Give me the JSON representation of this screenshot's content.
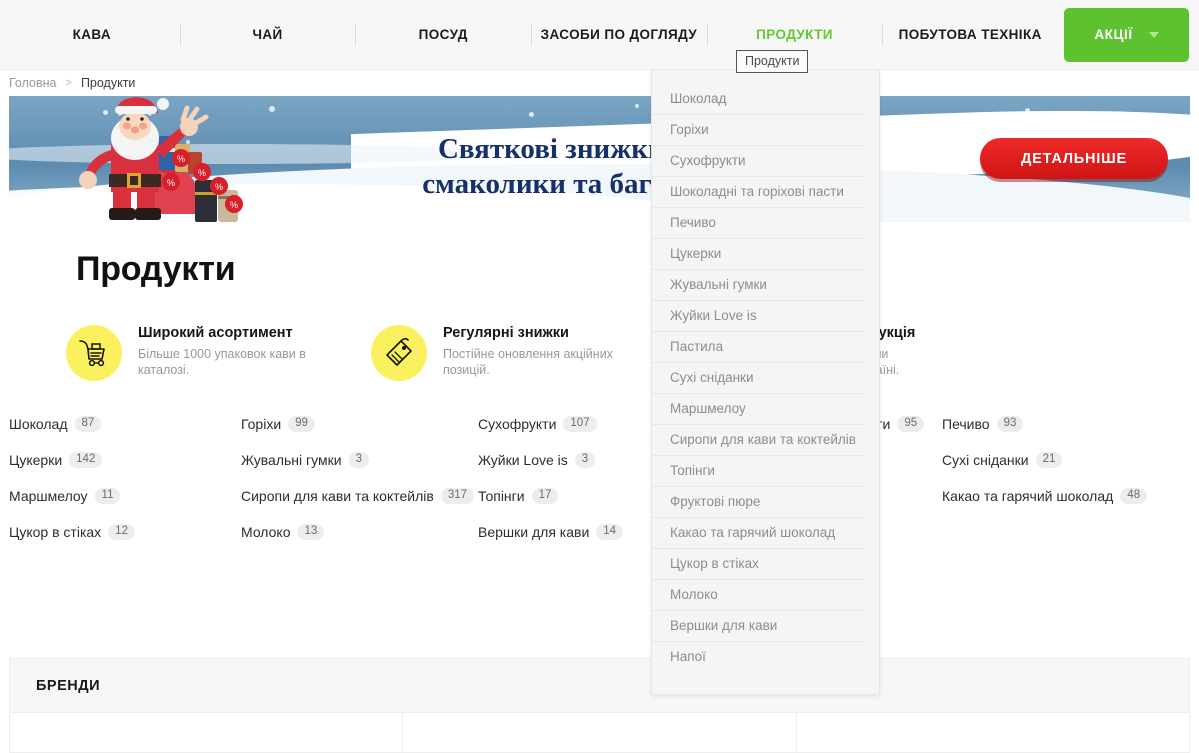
{
  "nav": {
    "items": [
      {
        "label": "КАВА",
        "active": false
      },
      {
        "label": "ЧАЙ",
        "active": false
      },
      {
        "label": "ПОСУД",
        "active": false
      },
      {
        "label": "ЗАСОБИ ПО ДОГЛЯДУ",
        "active": false
      },
      {
        "label": "ПРОДУКТИ",
        "active": true
      },
      {
        "label": "ПОБУТОВА ТЕХНІКА",
        "active": false
      }
    ],
    "promo_button": "АКЦІЇ",
    "active_color": "#64c832",
    "promo_color": "#5cc230"
  },
  "tooltip": {
    "text": "Продукти"
  },
  "dropdown": {
    "items": [
      "Шоколад",
      "Горіхи",
      "Сухофрукти",
      "Шоколадні та горіхові пасти",
      "Печиво",
      "Цукерки",
      "Жувальні гумки",
      "Жуйки Love is",
      "Пастила",
      "Сухі сніданки",
      "Маршмелоу",
      "Сиропи для кави та коктейлів",
      "Топінги",
      "Фруктові пюре",
      "Какао та гарячий шоколад",
      "Цукор в стіках",
      "Молоко",
      "Вершки для кави",
      "Напої"
    ]
  },
  "breadcrumb": {
    "home": "Головна",
    "separator": ">",
    "current": "Продукти"
  },
  "banner": {
    "line1": "Святкові знижки до -40%",
    "line2": "смаколики та багато іншого",
    "button": "ДЕТАЛЬНІШЕ",
    "button_color": "#e02222"
  },
  "page": {
    "title": "Продукти"
  },
  "features": [
    {
      "icon": "shopping-cart-icon",
      "title": "Широкий асортимент",
      "desc": "Більше 1000 упаковок кави в каталозі."
    },
    {
      "icon": "price-tag-icon",
      "title": "Регулярні знижки",
      "desc": "Постійне оновлення акційних позицій."
    },
    {
      "icon": "badge-check-icon",
      "title": "Оригінальна продукція",
      "desc": "Працюємо з офіційними постачальниками в країні."
    }
  ],
  "categories": [
    {
      "label": "Шоколад",
      "count": "87"
    },
    {
      "label": "Горіхи",
      "count": "99"
    },
    {
      "label": "Сухофрукти",
      "count": "107"
    },
    {
      "label": "Шоколадні та горіхові пасти",
      "count": "95"
    },
    {
      "label": "Печиво",
      "count": "93"
    },
    {
      "label": "Цукерки",
      "count": "142"
    },
    {
      "label": "Жувальні гумки",
      "count": "3"
    },
    {
      "label": "Жуйки Love is",
      "count": "3"
    },
    {
      "label": "Пастила",
      "count": ""
    },
    {
      "label": "Сухі сніданки",
      "count": "21"
    },
    {
      "label": "Маршмелоу",
      "count": "11"
    },
    {
      "label": "Сиропи для кави та коктейлів",
      "count": "317"
    },
    {
      "label": "Топінги",
      "count": "17"
    },
    {
      "label": "Фруктові пюре",
      "count": ""
    },
    {
      "label": "Какао та гарячий шоколад",
      "count": "48"
    },
    {
      "label": "Цукор в стіках",
      "count": "12"
    },
    {
      "label": "Молоко",
      "count": "13"
    },
    {
      "label": "Вершки для кави",
      "count": "14"
    },
    {
      "label": "Напої",
      "count": ""
    },
    {
      "label": "",
      "count": ""
    }
  ],
  "brands": {
    "title": "БРЕНДИ"
  }
}
